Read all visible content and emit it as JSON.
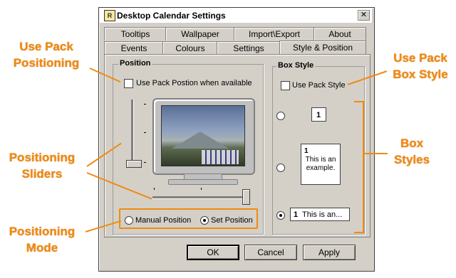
{
  "window": {
    "title": "Desktop Calendar Settings",
    "icon_text": "R",
    "close_glyph": "✕"
  },
  "tabs_back": [
    {
      "label": "Tooltips"
    },
    {
      "label": "Wallpaper"
    },
    {
      "label": "Import\\Export"
    },
    {
      "label": "About"
    }
  ],
  "tabs_front": [
    {
      "label": "Events"
    },
    {
      "label": "Colours"
    },
    {
      "label": "Settings"
    },
    {
      "label": "Style & Position",
      "active": true
    }
  ],
  "position": {
    "group_label": "Position",
    "use_pack_label": "Use Pack Postion when available",
    "manual_label": "Manual Position",
    "set_label": "Set Position",
    "selected": "Set Position"
  },
  "box_style": {
    "group_label": "Box Style",
    "use_pack_label": "Use Pack Style",
    "style1_num": "1",
    "style2_num": "1",
    "style2_text": "This is an example.",
    "style3_num": "1",
    "style3_text": "This is an...",
    "selected": 3
  },
  "buttons": {
    "ok": "OK",
    "cancel": "Cancel",
    "apply": "Apply"
  },
  "callouts": {
    "use_pack_positioning": "Use Pack Positioning",
    "positioning_sliders": "Positioning Sliders",
    "positioning_mode": "Positioning Mode",
    "use_pack_box_style": "Use Pack Box Style",
    "box_styles": "Box Styles"
  },
  "colors": {
    "callout": "#ef8a12",
    "dialog_bg": "#d4d0c8"
  }
}
